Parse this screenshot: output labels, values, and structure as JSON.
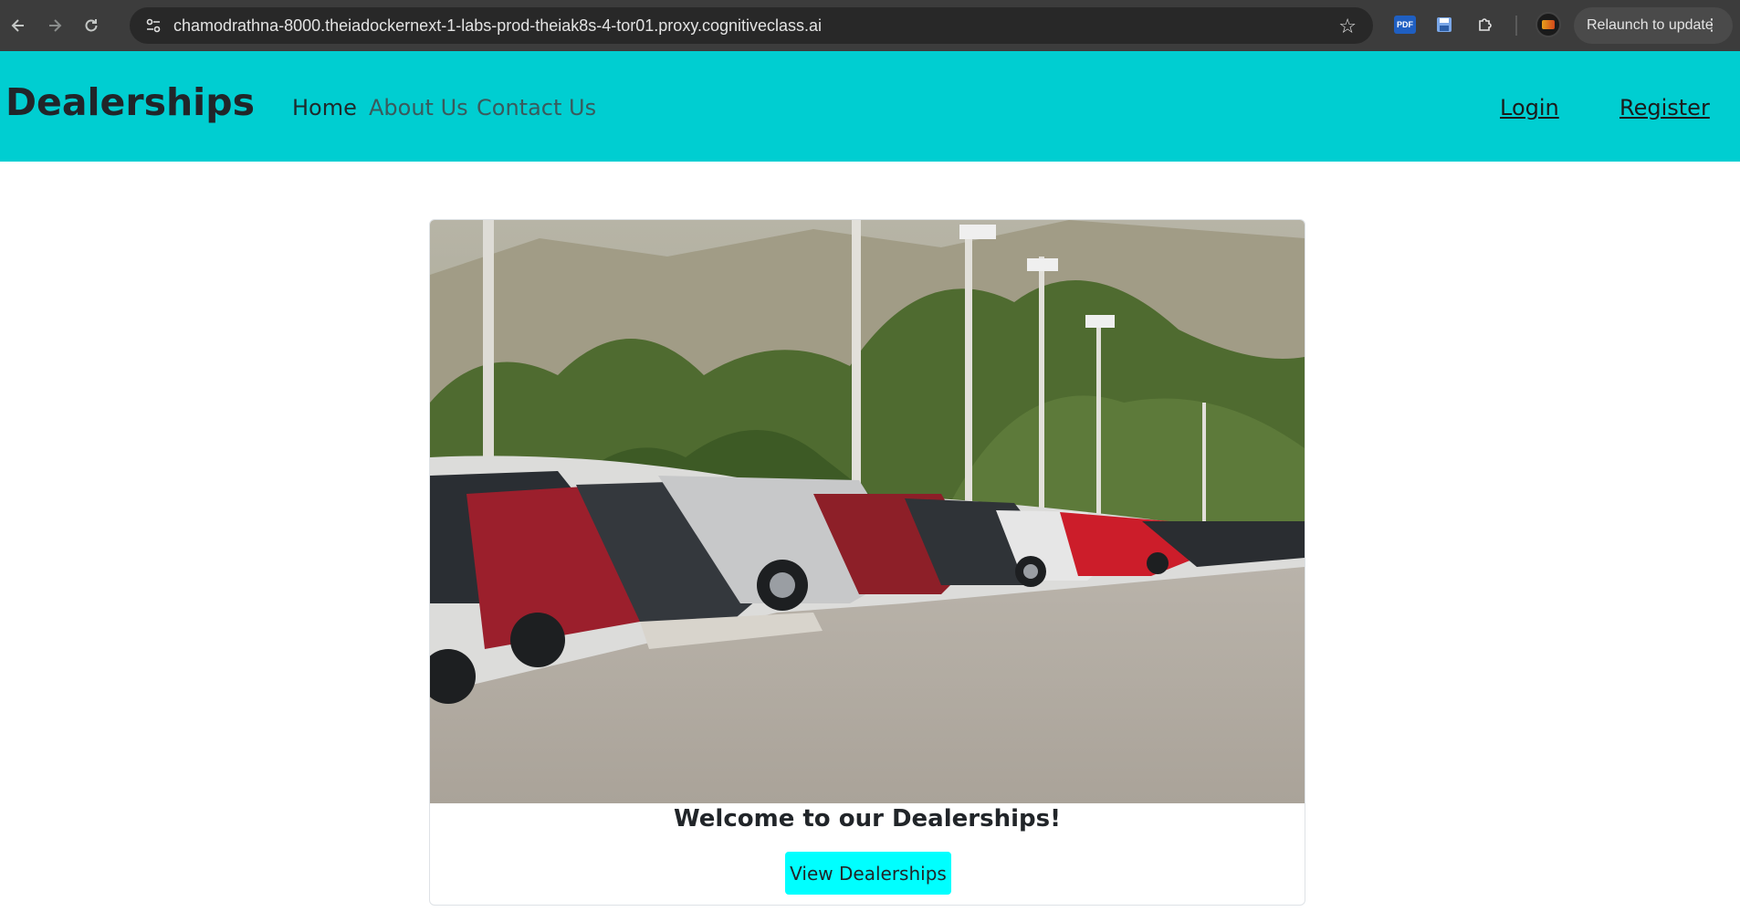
{
  "browser": {
    "url": "chamodrathna-8000.theiadockernext-1-labs-prod-theiak8s-4-tor01.proxy.cognitiveclass.ai",
    "relaunch_label": "Relaunch to update",
    "pdf_ext_label": "PDF",
    "icons": {
      "back": "back-arrow-icon",
      "forward": "forward-arrow-icon",
      "reload": "reload-icon",
      "site_info": "tune-icon",
      "bookmark": "star-icon",
      "save": "save-icon",
      "extensions": "puzzle-icon",
      "menu": "more-vert-icon"
    }
  },
  "navbar": {
    "brand": "Dealerships",
    "links": [
      {
        "label": "Home",
        "active": true
      },
      {
        "label": "About Us",
        "active": false
      },
      {
        "label": "Contact Us",
        "active": false
      }
    ],
    "login": "Login",
    "register": "Register",
    "color": "#00ced1"
  },
  "hero": {
    "title": "Welcome to our Dealerships!",
    "button_label": "View Dealerships",
    "button_color": "#00ffff"
  }
}
